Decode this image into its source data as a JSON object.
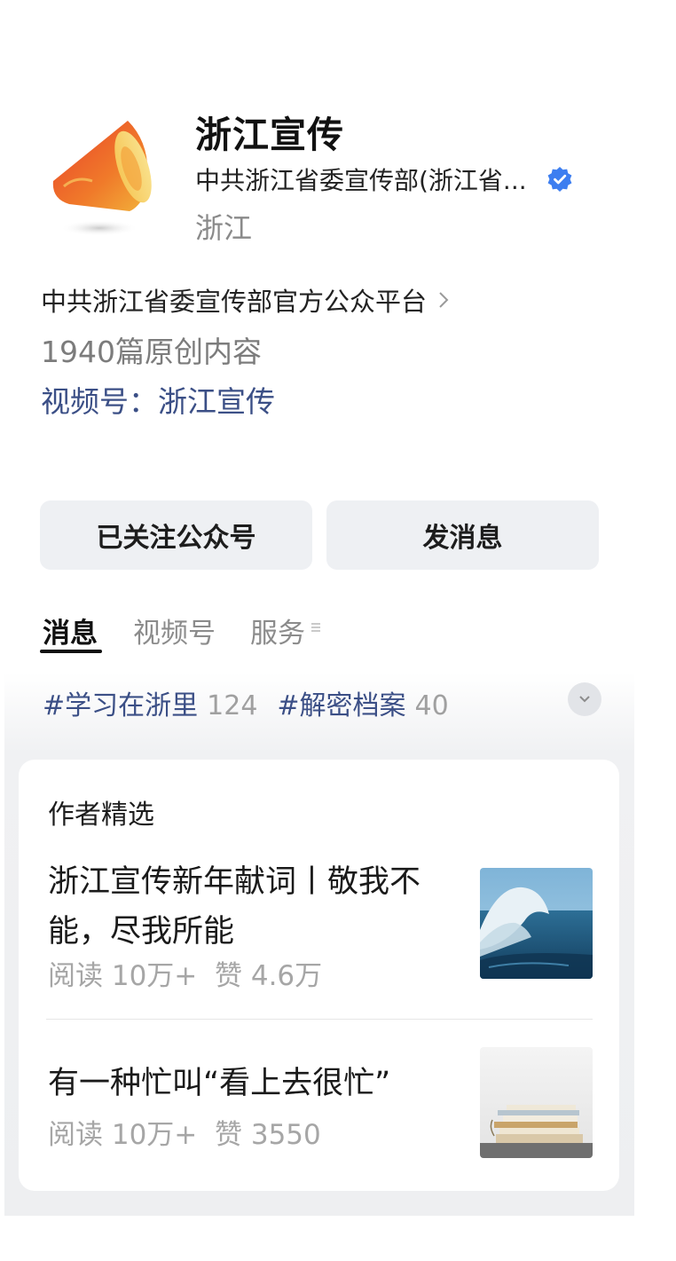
{
  "account": {
    "name": "浙江宣传",
    "org": "中共浙江省委宣传部(浙江省...",
    "region": "浙江",
    "description": "中共浙江省委宣传部官方公众平台",
    "original_count": "1940篇原创内容",
    "video_channel": "视频号：浙江宣传",
    "logo_icon": "megaphone-logo",
    "verified_icon": "verified-badge-icon",
    "verified_color": "#3d7ef0"
  },
  "buttons": {
    "follow": "已关注公众号",
    "message": "发消息"
  },
  "tabs": [
    {
      "label": "消息",
      "active": true
    },
    {
      "label": "视频号",
      "active": false
    },
    {
      "label": "服务",
      "active": false
    }
  ],
  "topics": [
    {
      "name": "#学习在浙里",
      "count": "124"
    },
    {
      "name": "#解密档案",
      "count": "40"
    }
  ],
  "featured": {
    "title": "作者精选",
    "articles": [
      {
        "title": "浙江宣传新年献词丨敬我不能，尽我所能",
        "reads": "阅读 10万+",
        "likes": "赞 4.6万",
        "thumb": "ocean-wave"
      },
      {
        "title": "有一种忙叫“看上去很忙”",
        "reads": "阅读 10万+",
        "likes": "赞 3550",
        "thumb": "book-stack"
      }
    ]
  }
}
